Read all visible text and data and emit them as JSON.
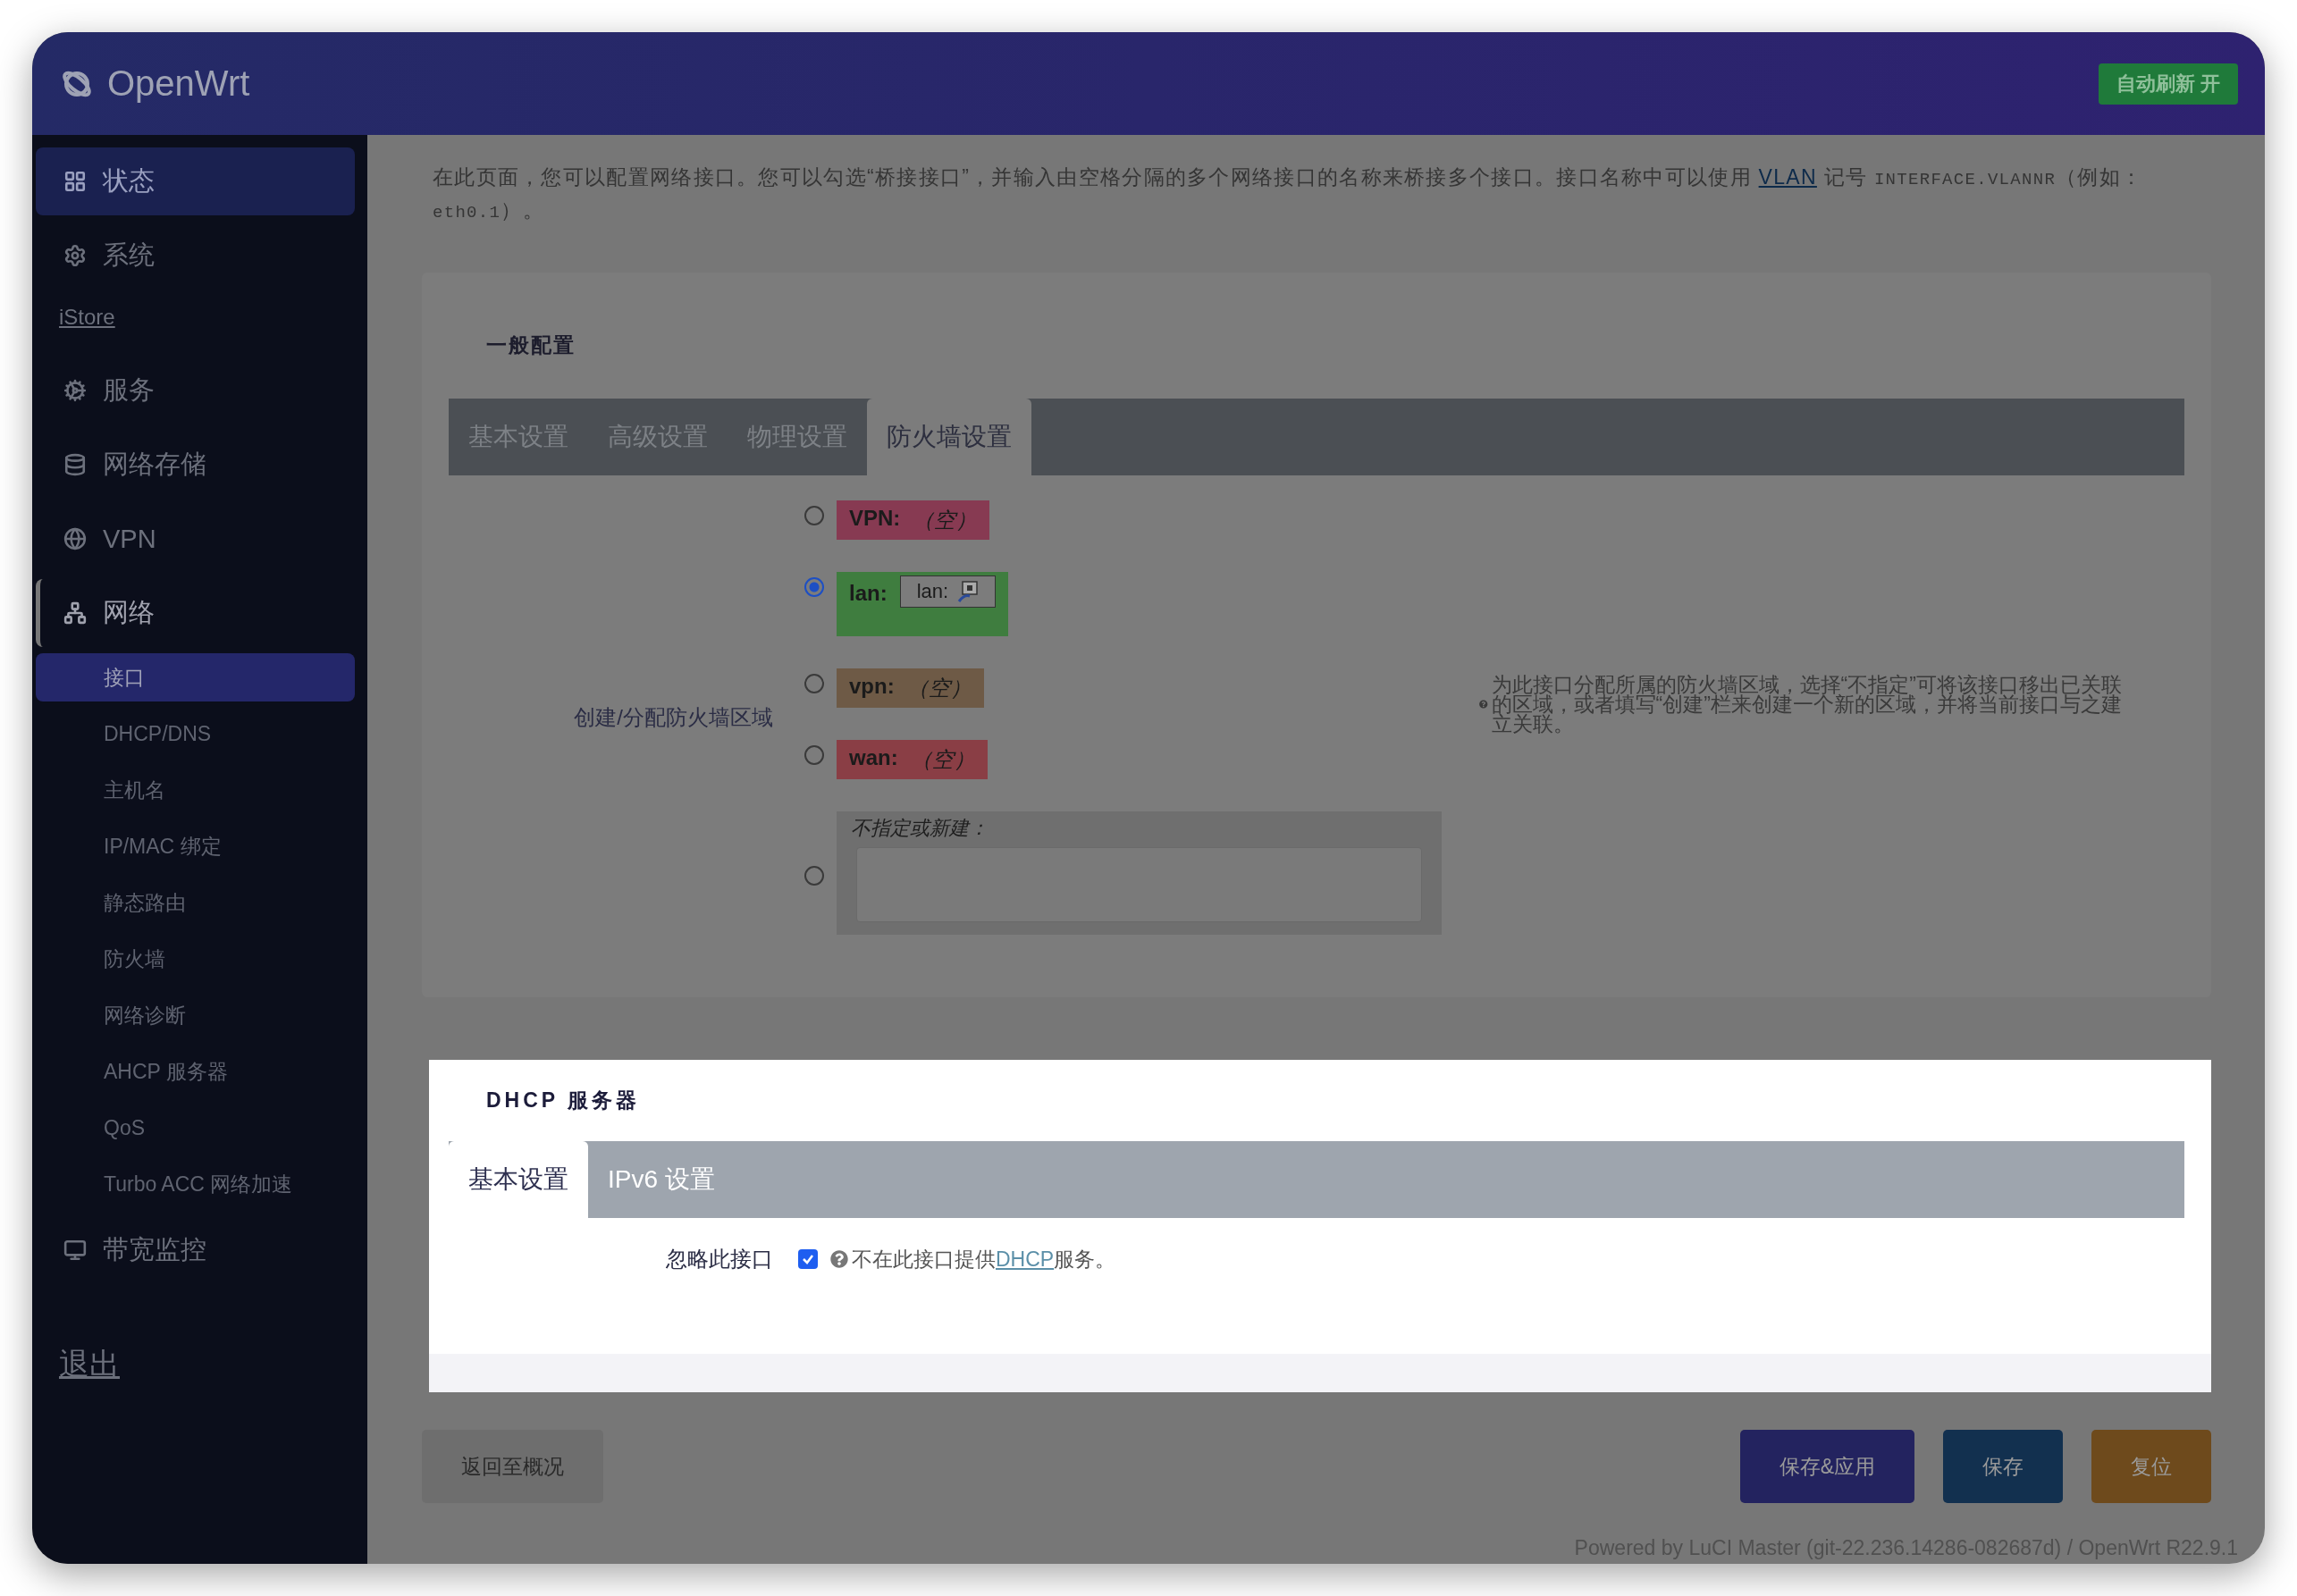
{
  "header": {
    "brand": "OpenWrt",
    "auto_refresh": {
      "label": "自动刷新 开",
      "on": true
    }
  },
  "sidebar": {
    "items": [
      {
        "kind": "menu",
        "label": "状态",
        "selected": true,
        "expanded": false
      },
      {
        "kind": "menu",
        "label": "系统",
        "selected": false,
        "expanded": false
      },
      {
        "kind": "link",
        "label": "iStore",
        "selected": false
      },
      {
        "kind": "menu",
        "label": "服务",
        "selected": false,
        "expanded": false
      },
      {
        "kind": "menu",
        "label": "网络存储",
        "selected": false,
        "expanded": false
      },
      {
        "kind": "menu",
        "label": "VPN",
        "selected": false,
        "expanded": false
      },
      {
        "kind": "menu",
        "label": "网络",
        "selected": false,
        "expanded": true,
        "children": [
          {
            "label": "接口",
            "selected": true
          },
          {
            "label": "DHCP/DNS",
            "selected": false
          },
          {
            "label": "主机名",
            "selected": false
          },
          {
            "label": "IP/MAC 绑定",
            "selected": false
          },
          {
            "label": "静态路由",
            "selected": false
          },
          {
            "label": "防火墙",
            "selected": false
          },
          {
            "label": "网络诊断",
            "selected": false
          },
          {
            "label": "AHCP 服务器",
            "selected": false
          },
          {
            "label": "QoS",
            "selected": false
          },
          {
            "label": "Turbo ACC 网络加速",
            "selected": false
          }
        ]
      },
      {
        "kind": "menu",
        "label": "带宽监控",
        "selected": false,
        "expanded": false
      }
    ],
    "logout": "退出"
  },
  "description": [
    {
      "kind": "text",
      "text": "在此页面，您可以配置网络接口。您可以勾选“桥接接口”，并输入由空格分隔的多个网络接口的名称来桥接多个接口。接口名称中可以使用 "
    },
    {
      "kind": "link",
      "text": "VLAN"
    },
    {
      "kind": "text",
      "text": " 记号 "
    },
    {
      "kind": "code",
      "text": "INTERFACE.VLANNR"
    },
    {
      "kind": "text",
      "text": "（例如："
    },
    {
      "kind": "code",
      "text": "eth0.1"
    },
    {
      "kind": "text",
      "text": "）。"
    }
  ],
  "general": {
    "title": "一般配置",
    "tabs": [
      {
        "label": "基本设置",
        "selected": false
      },
      {
        "label": "高级设置",
        "selected": false
      },
      {
        "label": "物理设置",
        "selected": false
      },
      {
        "label": "防火墙设置",
        "selected": true
      }
    ],
    "field_label": "创建/分配防火墙区域",
    "zones": [
      {
        "name": "VPN:",
        "empty": "（空）",
        "color": "#873a52",
        "selected": false
      },
      {
        "name": "lan:",
        "devices": [
          "lan:"
        ],
        "color": "#3f7d3f",
        "selected": true
      },
      {
        "name": "vpn:",
        "empty": "（空）",
        "color": "#6e5a46",
        "selected": false
      },
      {
        "name": "wan:",
        "empty": "（空）",
        "color": "#8a3e45",
        "selected": false
      }
    ],
    "custom": {
      "label": "不指定或新建：",
      "selected": false
    },
    "help": "为此接口分配所属的防火墙区域，选择“不指定”可将该接口移出已关联的区域，或者填写“创建”栏来创建一个新的区域，并将当前接口与之建立关联。"
  },
  "dhcp": {
    "title": "DHCP 服务器",
    "tabs": [
      {
        "label": "基本设置",
        "selected": true
      },
      {
        "label": "IPv6 设置",
        "selected": false
      }
    ],
    "ignore": {
      "label": "忽略此接口",
      "checked": true,
      "help": [
        {
          "kind": "text",
          "text": "不在此接口提供"
        },
        {
          "kind": "link",
          "text": "DHCP"
        },
        {
          "kind": "text",
          "text": "服务。"
        }
      ]
    }
  },
  "actions": {
    "back": "返回至概况",
    "buttons": [
      {
        "label": "保存&应用",
        "color": "#23235f"
      },
      {
        "label": "保存",
        "color": "#12304f"
      },
      {
        "label": "复位",
        "color": "#6e4a1c"
      }
    ]
  },
  "footer": "Powered by LuCI Master (git-22.236.14286-082687d) / OpenWrt R22.9.1"
}
